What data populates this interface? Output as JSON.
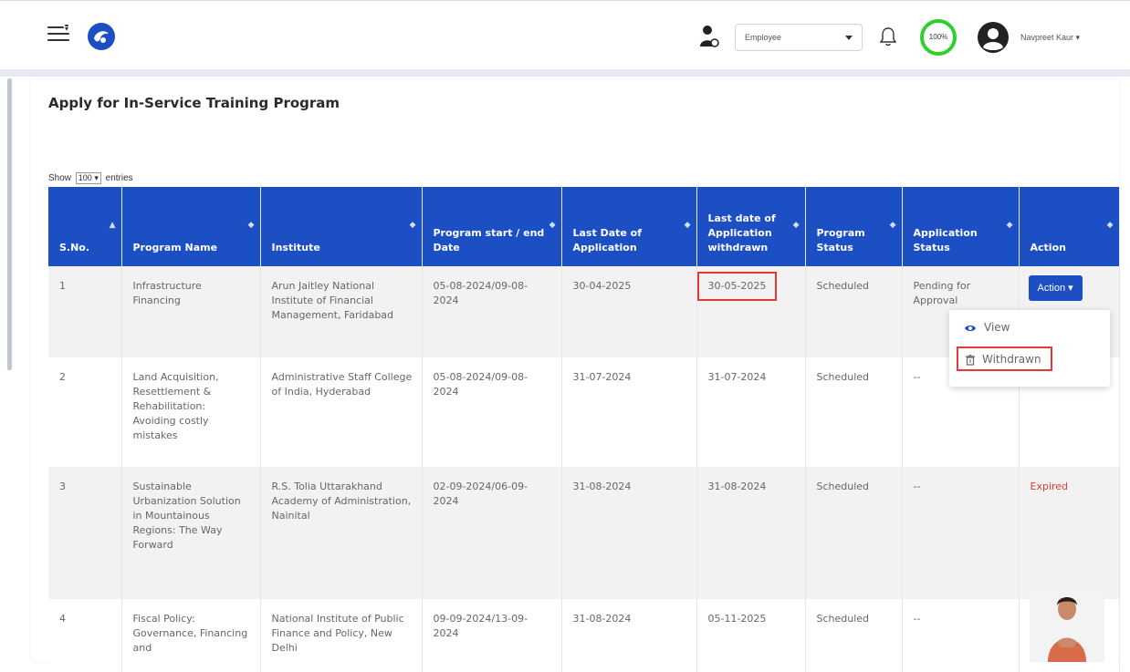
{
  "header": {
    "role_select_value": "Employee",
    "profile_percent": "100%",
    "user_name": "Navpreet Kaur"
  },
  "page": {
    "title": "Apply for In-Service Training Program",
    "show_label": "Show",
    "entries_value": "100",
    "entries_label": "entries"
  },
  "table": {
    "headers": [
      "S.No.",
      "Program Name",
      "Institute",
      "Program start / end Date",
      "Last Date of Application",
      "Last date of Application withdrawn",
      "Program Status",
      "Application Status",
      "Action"
    ],
    "rows": [
      {
        "sno": "1",
        "program": "Infrastructure Financing",
        "institute": "Arun Jaitley National Institute of Financial Management, Faridabad",
        "dates": "05-08-2024/09-08-2024",
        "last_date": "30-04-2025",
        "withdrawn_date": "30-05-2025",
        "program_status": "Scheduled",
        "app_status": "Pending for Approval",
        "action": "Action ▾"
      },
      {
        "sno": "2",
        "program": "Land Acquisition, Resettlement & Rehabilitation: Avoiding costly mistakes",
        "institute": "Administrative Staff College of India, Hyderabad",
        "dates": "05-08-2024/09-08-2024",
        "last_date": "31-07-2024",
        "withdrawn_date": "31-07-2024",
        "program_status": "Scheduled",
        "app_status": "--",
        "action": ""
      },
      {
        "sno": "3",
        "program": "Sustainable Urbanization Solution in Mountainous Regions: The Way Forward",
        "institute": "R.S. Tolia Uttarakhand Academy of Administration, Nainital",
        "dates": "02-09-2024/06-09-2024",
        "last_date": "31-08-2024",
        "withdrawn_date": "31-08-2024",
        "program_status": "Scheduled",
        "app_status": "--",
        "action": "Expired"
      },
      {
        "sno": "4",
        "program": "Fiscal Policy: Governance, Financing and",
        "institute": "National Institute of Public Finance and Policy, New Delhi",
        "dates": "09-09-2024/13-09-2024",
        "last_date": "31-08-2024",
        "withdrawn_date": "05-11-2025",
        "program_status": "Scheduled",
        "app_status": "--",
        "action": ""
      }
    ]
  },
  "dropdown": {
    "view_label": "View",
    "withdrawn_label": "Withdrawn"
  },
  "colors": {
    "header_blue": "#1c4fc4",
    "highlight_red": "#e53935",
    "progress_green": "#2ed02e"
  },
  "icons": [
    "menu-icon",
    "logo-icon",
    "user-role-icon",
    "bell-icon",
    "avatar-icon",
    "eye-icon",
    "trash-icon",
    "sort-icon",
    "chatbot-assistant-icon"
  ]
}
